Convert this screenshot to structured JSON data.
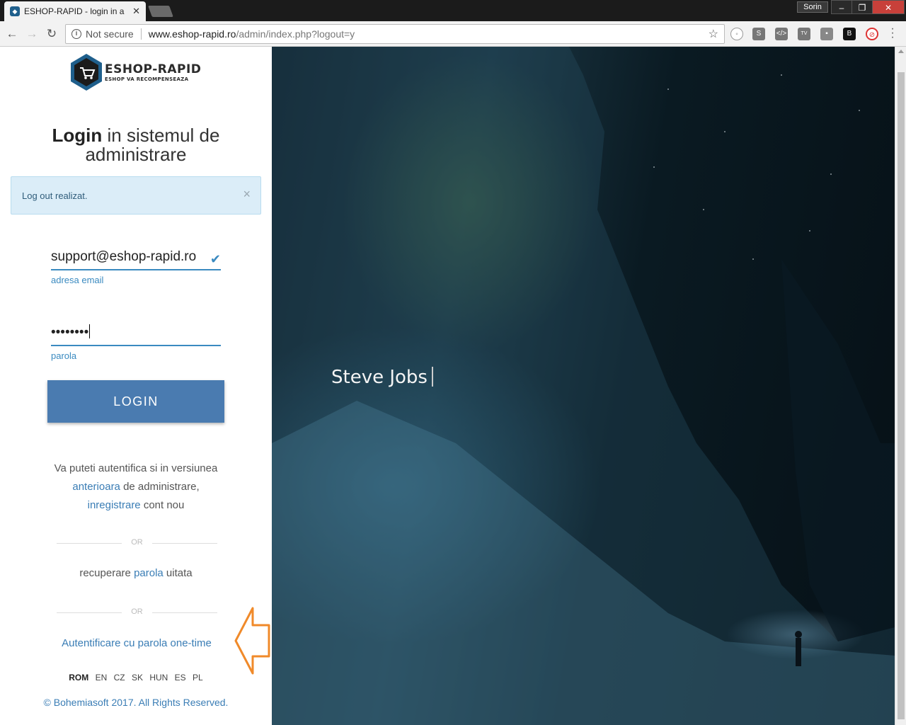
{
  "browser": {
    "tab_title": "ESHOP-RAPID - login in a",
    "user": "Sorin",
    "security": "Not secure",
    "url_host": "www.eshop-rapid.ro",
    "url_path": "/admin/index.php?logout=y"
  },
  "brand": {
    "name": "ESHOP-RAPID",
    "tagline": "ESHOP VA RECOMPENSEAZA"
  },
  "login": {
    "title_bold": "Login",
    "title_rest": " in sistemul de",
    "title_line2": "administrare",
    "alert_message": "Log out realizat.",
    "email_value": "support@eshop-rapid.ro",
    "email_label": "adresa email",
    "password_value": "••••••••",
    "password_label": "parola",
    "submit_label": "LOGIN"
  },
  "info": {
    "line1": "Va puteti autentifica si in versiunea",
    "link_previous": "anterioara",
    "line2_rest": " de administrare,",
    "link_register": "inregistrare",
    "line3_rest": " cont nou",
    "or": "OR",
    "recover_pre": "recuperare ",
    "recover_link": "parola",
    "recover_post": " uitata",
    "onetime": "Autentificare cu parola one-time"
  },
  "languages": [
    "ROM",
    "EN",
    "CZ",
    "SK",
    "HUN",
    "ES",
    "PL"
  ],
  "footer": "© Bohemiasoft 2017. All Rights Reserved.",
  "hero": {
    "quote_author": "Steve Jobs"
  },
  "colors": {
    "accent": "#4a7bb0",
    "link": "#3a7db5",
    "arrow": "#f08a2a"
  }
}
